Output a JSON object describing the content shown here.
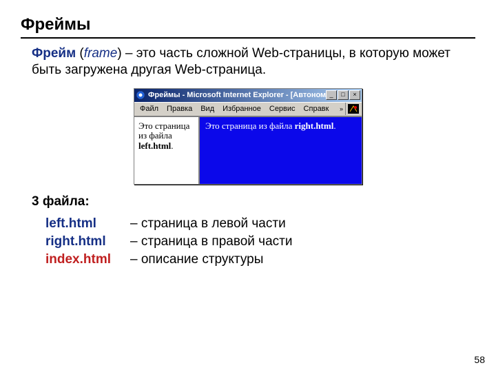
{
  "title": "Фреймы",
  "definition": {
    "term": "Фрейм",
    "italic": "frame",
    "rest": " – это часть сложной Web-страницы, в которую может быть загружена другая Web-страница."
  },
  "window": {
    "title": "Фреймы - Microsoft Internet Explorer - [Автоном..",
    "menu": {
      "m1": "Файл",
      "m2": "Правка",
      "m3": "Вид",
      "m4": "Избранное",
      "m5": "Сервис",
      "m6": "Справк"
    },
    "chevrons": "»",
    "left": {
      "line": "Это страница из файла ",
      "file": "left.html",
      "dot": "."
    },
    "right": {
      "line": "Это страница из файла ",
      "file": "right.html",
      "dot": "."
    }
  },
  "files": {
    "heading": "3 файла:",
    "rows": [
      {
        "name": "left.html",
        "desc": "– страница в левой части"
      },
      {
        "name": "right.html",
        "desc": "– страница в правой части"
      },
      {
        "name": "index.html",
        "desc": "– описание структуры"
      }
    ]
  },
  "page_number": "58"
}
